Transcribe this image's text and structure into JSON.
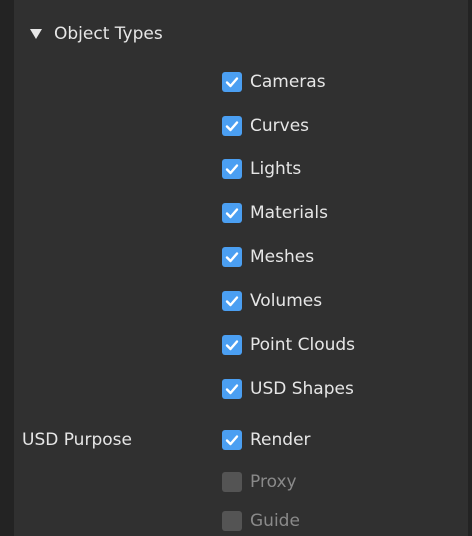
{
  "section": {
    "title": "Object Types",
    "icon": "triangle-down-icon"
  },
  "object_types": [
    {
      "label": "Cameras",
      "checked": true
    },
    {
      "label": "Curves",
      "checked": true
    },
    {
      "label": "Lights",
      "checked": true
    },
    {
      "label": "Materials",
      "checked": true
    },
    {
      "label": "Meshes",
      "checked": true
    },
    {
      "label": "Volumes",
      "checked": true
    },
    {
      "label": "Point Clouds",
      "checked": true
    },
    {
      "label": "USD Shapes",
      "checked": true
    }
  ],
  "purpose": {
    "label": "USD Purpose",
    "options": [
      {
        "label": "Render",
        "checked": true
      },
      {
        "label": "Proxy",
        "checked": false
      },
      {
        "label": "Guide",
        "checked": false
      }
    ]
  },
  "colors": {
    "background": "#303030",
    "checkbox_checked": "#4b9ff2",
    "checkbox_unchecked": "#545454"
  }
}
